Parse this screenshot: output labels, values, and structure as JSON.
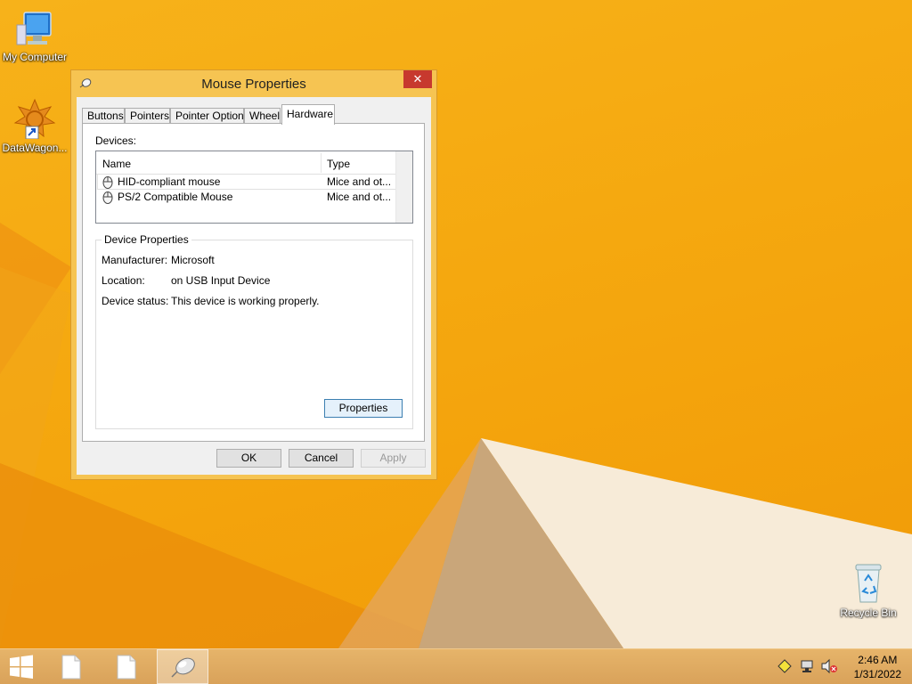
{
  "desktop": {
    "icons": [
      {
        "label": "My Computer"
      },
      {
        "label": "DataWagon..."
      },
      {
        "label": "Recycle Bin"
      }
    ]
  },
  "dialog": {
    "title": "Mouse Properties",
    "close_label": "✕",
    "tabs": [
      {
        "label": "Buttons"
      },
      {
        "label": "Pointers"
      },
      {
        "label": "Pointer Options"
      },
      {
        "label": "Wheel"
      },
      {
        "label": "Hardware"
      }
    ],
    "active_tab": "Hardware",
    "devices_label": "Devices:",
    "columns": {
      "name": "Name",
      "type": "Type"
    },
    "devices": [
      {
        "name": "HID-compliant mouse",
        "type": "Mice and ot..."
      },
      {
        "name": "PS/2 Compatible Mouse",
        "type": "Mice and ot..."
      }
    ],
    "device_properties": {
      "title": "Device Properties",
      "manufacturer_label": "Manufacturer:",
      "manufacturer_value": "Microsoft",
      "location_label": "Location:",
      "location_value": "on USB Input Device",
      "status_label": "Device status:",
      "status_value": "This device is working properly."
    },
    "buttons": {
      "properties": "Properties",
      "ok": "OK",
      "cancel": "Cancel",
      "apply": "Apply"
    }
  },
  "taskbar": {
    "clock_time": "2:46 AM",
    "clock_date": "1/31/2022"
  },
  "colors": {
    "desktop": "#f5a80f",
    "dialog_frame": "#f6c452",
    "close_button": "#c7392e"
  }
}
